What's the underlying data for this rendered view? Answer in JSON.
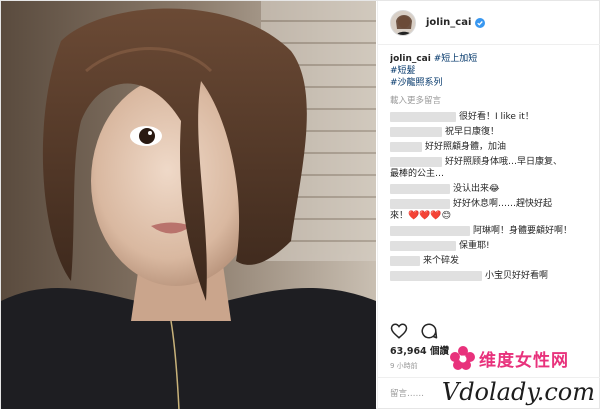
{
  "post": {
    "username": "jolin_cai",
    "caption": {
      "user": "jolin_cai",
      "tags": [
        "#短上加短",
        "#短髮",
        "#沙龍照系列"
      ]
    },
    "load_more": "載入更多留言",
    "comments": [
      {
        "text": "很好看！I like it！"
      },
      {
        "text": "祝早日康復！"
      },
      {
        "text": "好好照顧身體，加油"
      },
      {
        "text": "好好照顾身体哦…早日康复、"
      },
      {
        "text": "最棒的公主…"
      },
      {
        "text": "没认出来😂"
      },
      {
        "text": "好好休息啊……趕快好起"
      },
      {
        "text": "來！❤️❤️❤️😊"
      },
      {
        "text": "阿琳啊！身體要顧好啊！"
      },
      {
        "text": "保重耶!"
      },
      {
        "text": "来个碎发"
      },
      {
        "text": "小宝贝好好看啊"
      }
    ],
    "likes": "63,964 個讚",
    "time": "9 小時前",
    "add_comment_placeholder": "留言……"
  },
  "watermark": {
    "cn": "维度女性网",
    "en": "Vdolady.com"
  },
  "colors": {
    "link": "#003569",
    "verified": "#3897f0",
    "watermark_pink": "#e8327c"
  },
  "icons": [
    "heart-icon",
    "comment-icon",
    "verified-badge-icon"
  ]
}
